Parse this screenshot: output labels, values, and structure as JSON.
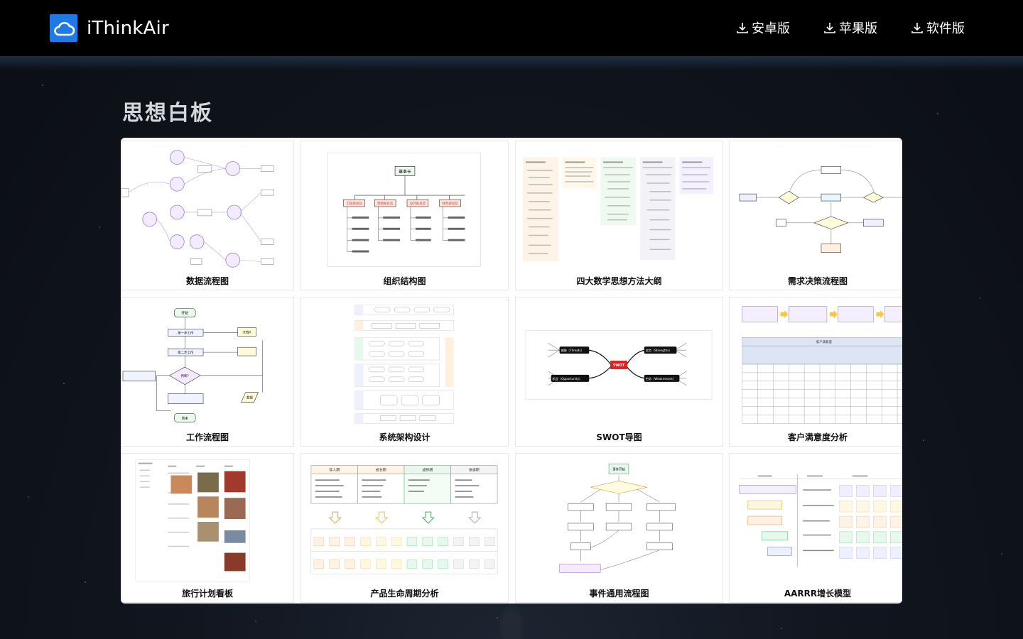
{
  "header": {
    "brand": "iThinkAir",
    "downloads": [
      {
        "label": "安卓版",
        "icon": "download-icon"
      },
      {
        "label": "苹果版",
        "icon": "download-icon"
      },
      {
        "label": "软件版",
        "icon": "download-icon"
      }
    ]
  },
  "section": {
    "title": "思想白板"
  },
  "templates": [
    {
      "label": "数据流程图"
    },
    {
      "label": "组织结构图"
    },
    {
      "label": "四大数学思想方法大纲"
    },
    {
      "label": "需求决策流程图"
    },
    {
      "label": "工作流程图"
    },
    {
      "label": "系统架构设计"
    },
    {
      "label": "SWOT导图"
    },
    {
      "label": "客户满意度分析"
    },
    {
      "label": "旅行计划看板"
    },
    {
      "label": "产品生命周期分析"
    },
    {
      "label": "事件通用流程图"
    },
    {
      "label": "AARRR增长模型"
    }
  ],
  "thumbs": {
    "org": {
      "root": "董事长",
      "depts": [
        "工程部总监",
        "营销部总监",
        "设计部总监",
        "财务部总监"
      ]
    },
    "swot": {
      "center": "SWOT",
      "threats": "威胁（Threats）",
      "strengths": "优势（Strengths）",
      "opportunity": "机会（Opportunity）",
      "weakness": "劣势（Weaknesses）"
    },
    "flow": {
      "start": "开始",
      "step1": "第一步工作",
      "step2": "第二步工作",
      "decision": "判断?",
      "end": "结束",
      "doc": "文档A",
      "data": "数据"
    },
    "lifecycle": {
      "phases": [
        "导入期",
        "成长期",
        "成熟期",
        "衰退期"
      ]
    },
    "event": {
      "start": "事件开始"
    },
    "customer": {
      "table_title": "客户满意度"
    }
  }
}
